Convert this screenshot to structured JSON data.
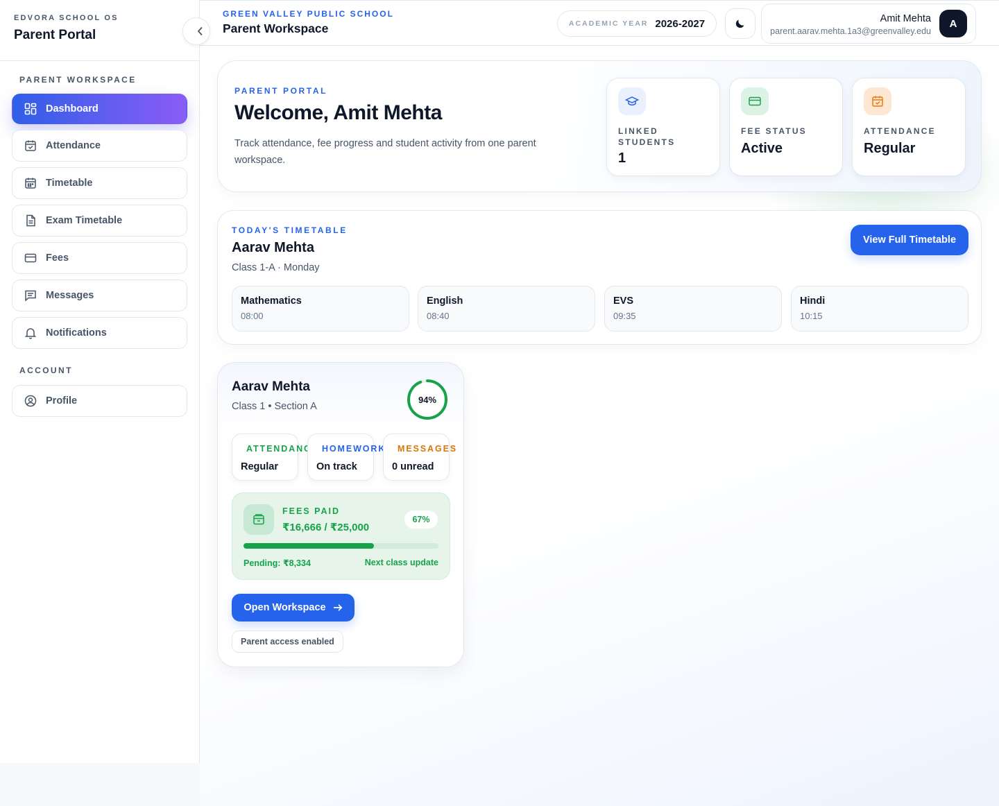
{
  "sidebar": {
    "brand_small": "EDVORA SCHOOL OS",
    "brand_title": "Parent Portal",
    "workspace_label": "PARENT WORKSPACE",
    "items": [
      {
        "label": "Dashboard",
        "icon": "grid-icon",
        "active": true
      },
      {
        "label": "Attendance",
        "icon": "calendar-check-icon"
      },
      {
        "label": "Timetable",
        "icon": "calendar-icon"
      },
      {
        "label": "Exam Timetable",
        "icon": "document-icon"
      },
      {
        "label": "Fees",
        "icon": "credit-card-icon"
      },
      {
        "label": "Messages",
        "icon": "message-icon"
      },
      {
        "label": "Notifications",
        "icon": "bell-icon"
      }
    ],
    "account_label": "ACCOUNT",
    "account_items": [
      {
        "label": "Profile",
        "icon": "user-circle-icon"
      }
    ]
  },
  "header": {
    "school_name": "GREEN VALLEY PUBLIC SCHOOL",
    "workspace_title": "Parent Workspace",
    "academic_year_label": "ACADEMIC YEAR",
    "academic_year": "2026-2027",
    "theme_icon": "moon-icon",
    "user_name": "Amit Mehta",
    "user_email": "parent.aarav.mehta.1a3@greenvalley.edu",
    "avatar_initial": "A"
  },
  "welcome": {
    "eyebrow": "PARENT PORTAL",
    "title": "Welcome, Amit Mehta",
    "description": "Track attendance, fee progress and student activity from one parent workspace.",
    "stats": [
      {
        "label": "LINKED STUDENTS",
        "value": "1",
        "icon": "graduation-cap-icon",
        "color": "#2563eb"
      },
      {
        "label": "FEE STATUS",
        "value": "Active",
        "icon": "credit-card-icon",
        "color": "#16a34a"
      },
      {
        "label": "ATTENDANCE",
        "value": "Regular",
        "icon": "calendar-check-icon",
        "color": "#ea7a0c"
      }
    ]
  },
  "timetable": {
    "eyebrow": "TODAY'S TIMETABLE",
    "student": "Aarav Mehta",
    "subtitle": "Class 1-A · Monday",
    "button": "View Full Timetable",
    "periods": [
      {
        "subject": "Mathematics",
        "time": "08:00"
      },
      {
        "subject": "English",
        "time": "08:40"
      },
      {
        "subject": "EVS",
        "time": "09:35"
      },
      {
        "subject": "Hindi",
        "time": "10:15"
      }
    ]
  },
  "student_card": {
    "name": "Aarav Mehta",
    "class": "Class 1 • Section A",
    "attendance_percent": 94,
    "attendance_percent_label": "94%",
    "stats": [
      {
        "label": "ATTENDANCE",
        "value": "Regular",
        "color": "#16a34a"
      },
      {
        "label": "HOMEWORK",
        "value": "On track",
        "color": "#2563eb"
      },
      {
        "label": "MESSAGES",
        "value": "0 unread",
        "color": "#d97706"
      }
    ],
    "fees": {
      "label": "FEES PAID",
      "amount": "₹16,666 / ₹25,000",
      "percent": 67,
      "percent_label": "67%",
      "pending": "Pending: ₹8,334",
      "next": "Next class update"
    },
    "open_button": "Open Workspace",
    "access_chip": "Parent access enabled"
  }
}
